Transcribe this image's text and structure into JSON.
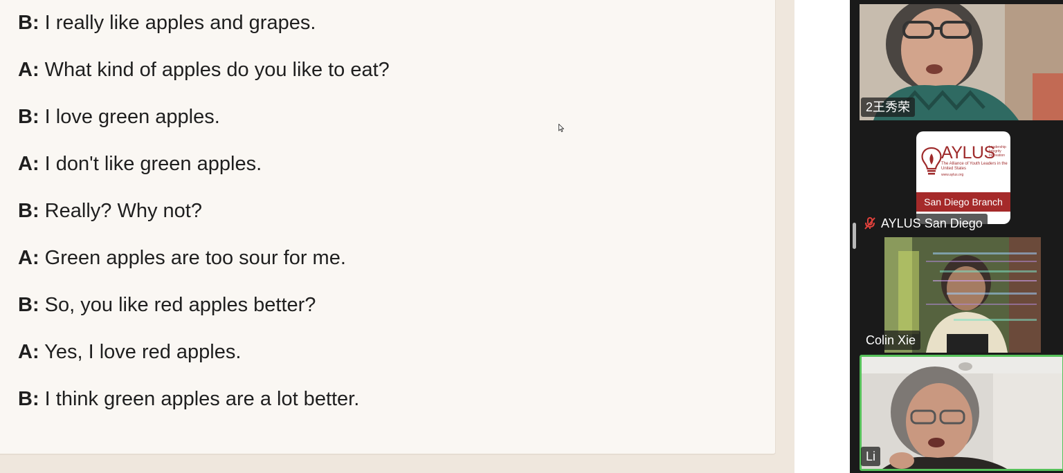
{
  "document": {
    "lines": [
      {
        "speaker": "B:",
        "text": "I really like apples and grapes."
      },
      {
        "speaker": "A:",
        "text": "What kind of apples do you like to eat?"
      },
      {
        "speaker": "B:",
        "text": "I love green apples."
      },
      {
        "speaker": "A:",
        "text": "I don't like green apples."
      },
      {
        "speaker": "B:",
        "text": "Really? Why not?"
      },
      {
        "speaker": "A:",
        "text": "Green apples are too sour for me."
      },
      {
        "speaker": "B:",
        "text": "So, you like red apples better?"
      },
      {
        "speaker": "A:",
        "text": "Yes, I love red apples."
      },
      {
        "speaker": "B:",
        "text": "I think green apples are a lot better."
      }
    ]
  },
  "gallery": {
    "participants": [
      {
        "name": "2王秀荣",
        "muted": false,
        "active_speaker": false
      },
      {
        "name": "AYLUS San Diego",
        "muted": true,
        "active_speaker": false,
        "mic_icon": "mic-muted-icon"
      },
      {
        "name": "Colin Xie",
        "muted": false,
        "active_speaker": false
      },
      {
        "name": "Li",
        "muted": false,
        "active_speaker": true
      }
    ],
    "active_speaker_color": "#56c15a",
    "muted_icon_color": "#e0413c"
  },
  "logo": {
    "word": "AYLUS",
    "tagline": "Leadership Integrity Innovation",
    "alliance": "The Alliance of Youth Leaders in the United States",
    "url": "www.aylus.org",
    "branch": "San Diego Branch",
    "brand_color": "#a52a2a"
  }
}
